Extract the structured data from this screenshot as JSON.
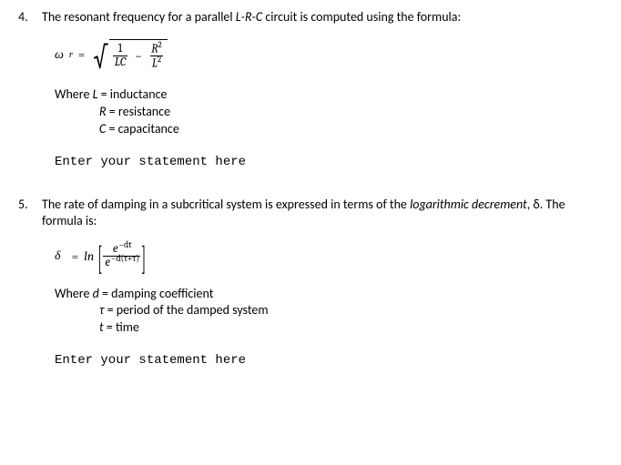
{
  "q4": {
    "number": "4.",
    "prompt_pre": "The resonant frequency for a parallel ",
    "prompt_ital": "L-R-C",
    "prompt_post": " circuit is computed using the formula:",
    "formula": {
      "lhs_sym": "ω",
      "lhs_sub": "r",
      "equals": "=",
      "frac1_num": "1",
      "frac1_den_L": "L",
      "frac1_den_C": "C",
      "minus": "−",
      "frac2_num_R": "R",
      "frac2_num_exp": "2",
      "frac2_den_L": "L",
      "frac2_den_exp": "2"
    },
    "defs_lead": "Where ",
    "def1_sym": "L",
    "def1_txt": " = inductance",
    "def2_sym": "R",
    "def2_txt": " = resistance",
    "def3_sym": "C",
    "def3_txt": " = capacitance",
    "placeholder": "Enter your statement here"
  },
  "q5": {
    "number": "5.",
    "prompt_a": "The rate of damping in a subcritical system is expressed in terms of the ",
    "prompt_ital": "logarithmic decrement",
    "prompt_b": ", δ. The formula is:",
    "formula": {
      "lhs": "δ",
      "equals": "=",
      "ln": "ln",
      "e": "e",
      "num_exp": "−dt",
      "den_exp": "−d(t+τ)"
    },
    "defs_lead": "Where ",
    "def1_sym": "d",
    "def1_txt": " = damping coefficient",
    "def2_sym": "τ",
    "def2_txt": " = period of the damped system",
    "def3_sym": "t",
    "def3_txt": " = time",
    "placeholder": "Enter your statement here"
  }
}
